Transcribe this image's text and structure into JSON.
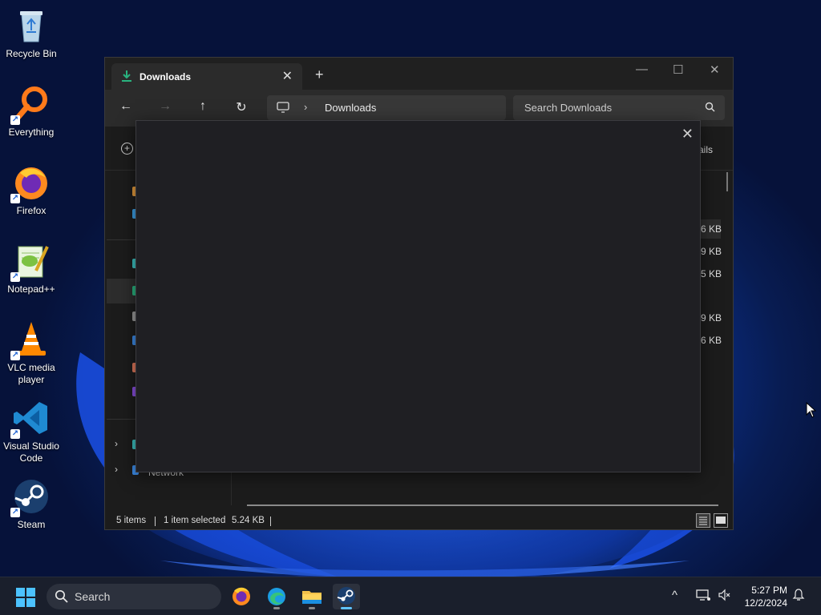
{
  "desktop": {
    "icons": [
      {
        "label": "Recycle Bin",
        "icon": "recycle-bin-icon"
      },
      {
        "label": "Everything",
        "icon": "everything-search-icon"
      },
      {
        "label": "Firefox",
        "icon": "firefox-icon"
      },
      {
        "label": "Notepad++",
        "icon": "notepad-plus-plus-icon"
      },
      {
        "label": "VLC media player",
        "icon": "vlc-cone-icon"
      },
      {
        "label": "Visual Studio Code",
        "icon": "vscode-icon"
      },
      {
        "label": "Steam",
        "icon": "steam-icon"
      }
    ]
  },
  "explorer": {
    "tab_title": "Downloads",
    "tab_close": "✕",
    "new_tab": "+",
    "window_controls": {
      "minimize": "—",
      "maximize": "☐",
      "close": "✕"
    },
    "nav": {
      "back": "←",
      "forward": "→",
      "up": "↑",
      "refresh": "↻"
    },
    "address": {
      "chevron": "›",
      "location": "Downloads"
    },
    "search": {
      "placeholder": "Search Downloads"
    },
    "command_bar": {
      "details_partial": "ails",
      "new_glyph": "+"
    },
    "file_sizes": [
      "6 KB",
      "9 KB",
      "5 KB",
      "9 KB",
      "6 KB"
    ],
    "nav_expanders": [
      "›",
      "›"
    ],
    "nav_partial_label": "Network",
    "status": {
      "item_count": "5 items",
      "selected": "1 item selected",
      "selected_size": "5.24 KB"
    }
  },
  "dialog": {
    "close": "✕"
  },
  "taskbar": {
    "search_label": "Search",
    "apps": [
      "firefox-icon",
      "edge-icon",
      "file-explorer-icon",
      "steam-icon"
    ],
    "active_app": "steam-icon",
    "tray": {
      "overflow": "^"
    },
    "clock": {
      "time": "5:27 PM",
      "date": "12/2/2024"
    }
  },
  "colors": {
    "accent": "#5ec3ff",
    "window_bg": "#1c1c1c",
    "dialog_bg": "#1f1f23",
    "download_icon": "#29b37f"
  }
}
